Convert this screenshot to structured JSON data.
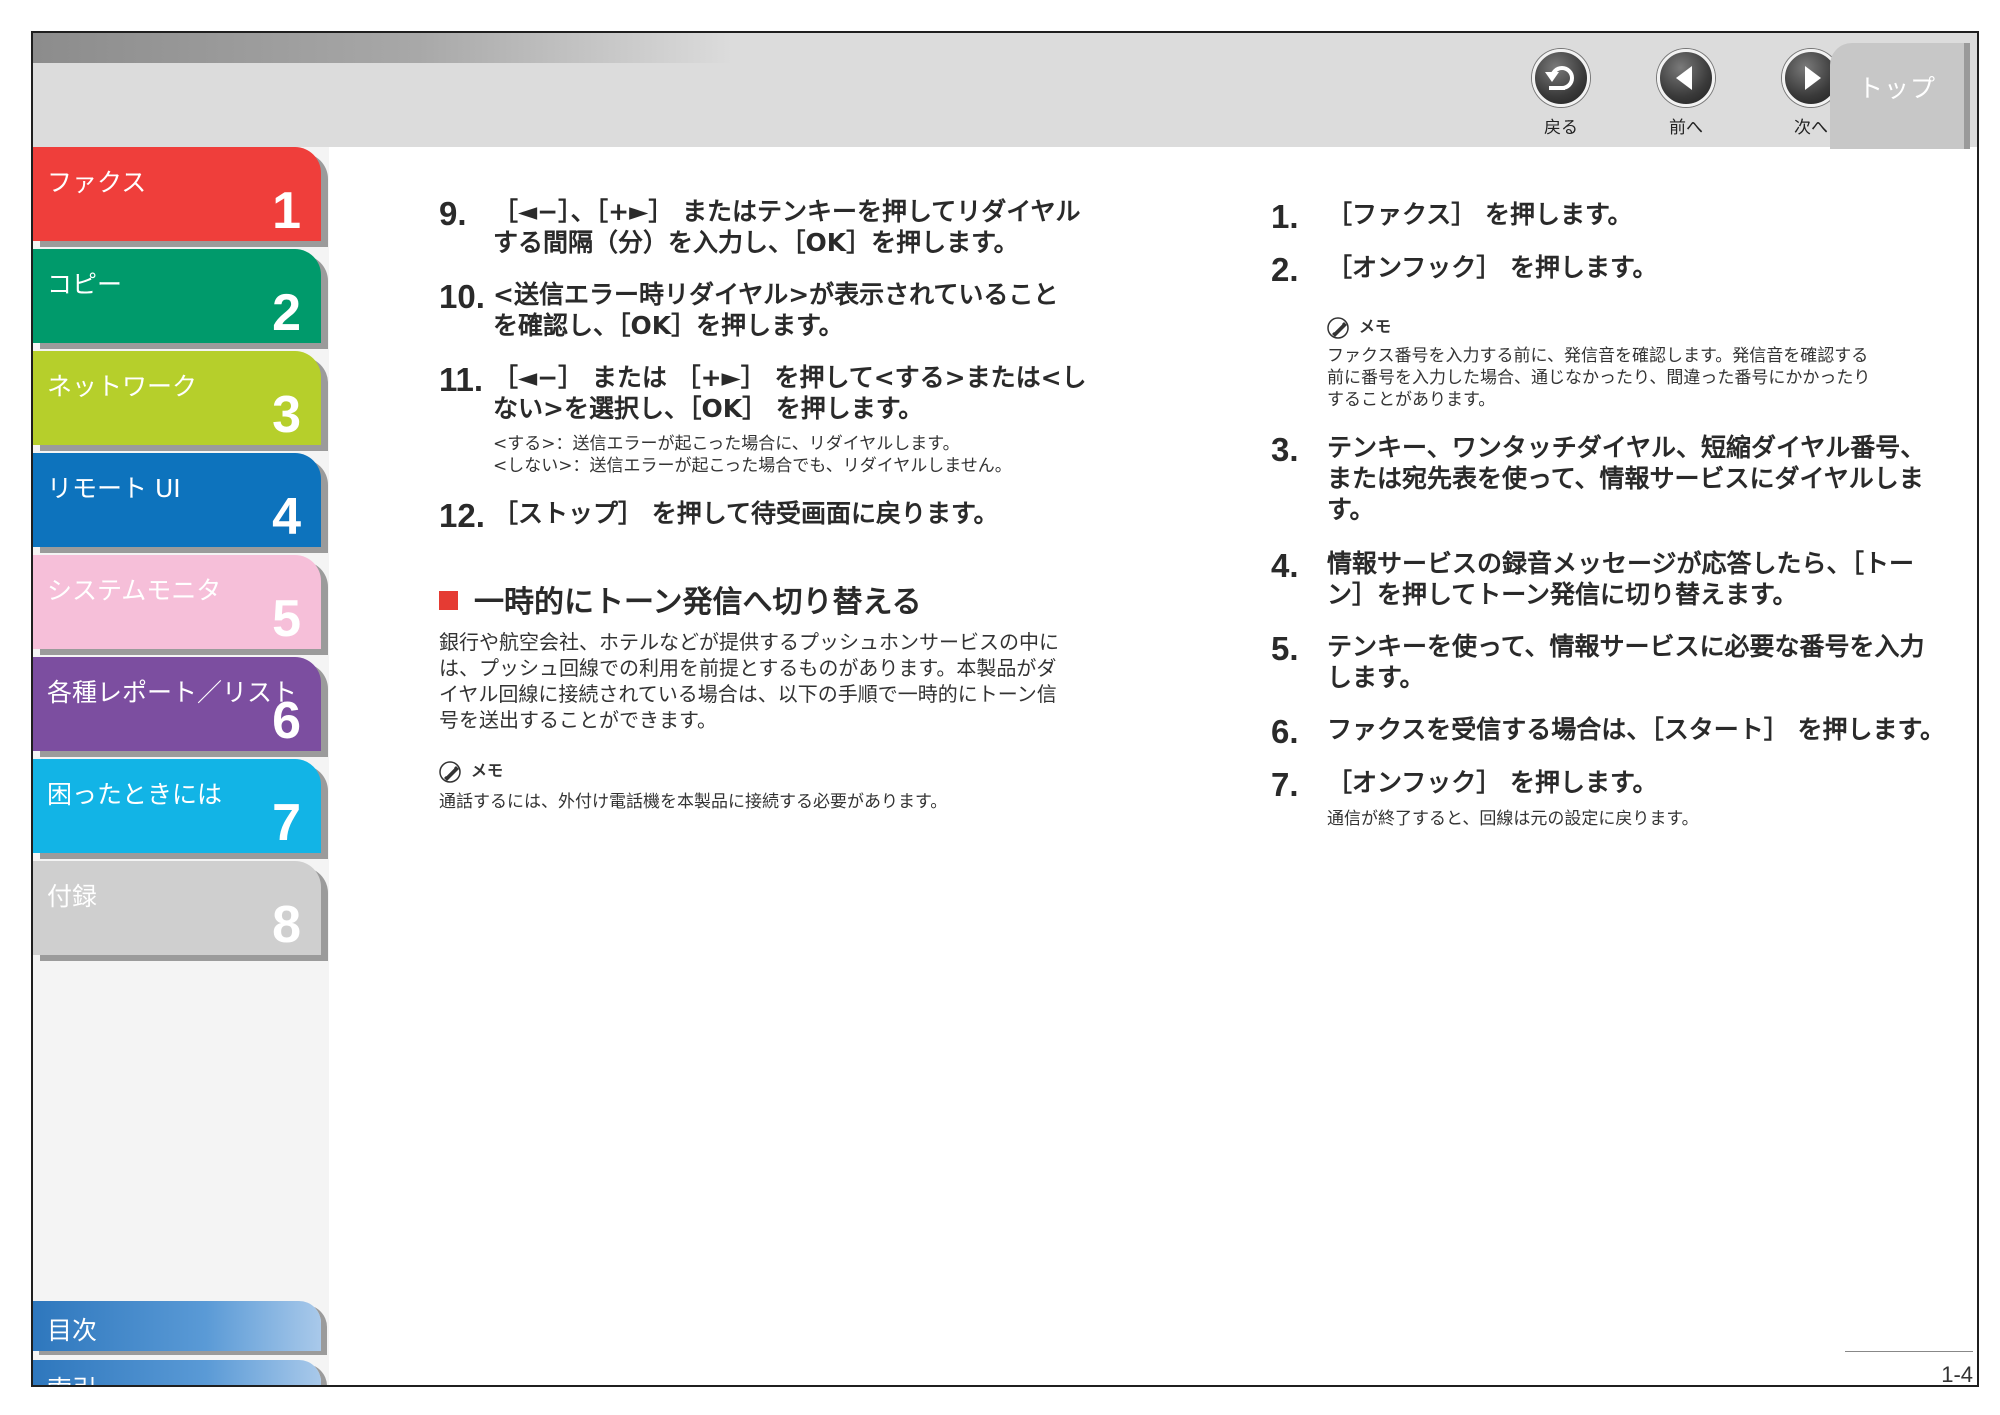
{
  "header": {
    "back_label": "戻る",
    "prev_label": "前へ",
    "next_label": "次へ",
    "top_label": "トップ"
  },
  "sidebar": {
    "chapters": [
      {
        "label": "ファクス",
        "num": "1",
        "color": "#ef3e3b"
      },
      {
        "label": "コピー",
        "num": "2",
        "color": "#009a6b"
      },
      {
        "label": "ネットワーク",
        "num": "3",
        "color": "#b6cf2b"
      },
      {
        "label": "リモート UI",
        "num": "4",
        "color": "#0d73bd"
      },
      {
        "label": "システムモニタ",
        "num": "5",
        "color": "#f6bfd9"
      },
      {
        "label": "各種レポート／リスト",
        "num": "6",
        "color": "#7c4ea0"
      },
      {
        "label": "困ったときには",
        "num": "7",
        "color": "#12b4e6"
      },
      {
        "label": "付録",
        "num": "8",
        "color": "#cfcfcf"
      }
    ],
    "toc_label": "目次",
    "index_label": "索引"
  },
  "left": {
    "steps": [
      {
        "num": "9.",
        "lines": [
          "［◄−］、［+►］ またはテンキーを押してリダイヤル",
          "する間隔（分）を入力し、［OK］を押します。"
        ]
      },
      {
        "num": "10.",
        "lines": [
          "<送信エラー時リダイヤル>が表示されていること",
          "を確認し、［OK］を押します。"
        ]
      },
      {
        "num": "11.",
        "lines": [
          "［◄−］ または ［+►］ を押して<する>または<し",
          "ない>を選択し、［OK］ を押します。"
        ],
        "notes": [
          "<する>：送信エラーが起こった場合に、リダイヤルします。",
          "<しない>：送信エラーが起こった場合でも、リダイヤルしません。"
        ]
      },
      {
        "num": "12.",
        "lines": [
          "［ストップ］ を押して待受画面に戻ります。"
        ]
      }
    ],
    "section_title": "一時的にトーン発信へ切り替える",
    "section_body": [
      "銀行や航空会社、ホテルなどが提供するプッシュホンサービスの中に",
      "は、プッシュ回線での利用を前提とするものがあります。本製品がダ",
      "イヤル回線に接続されている場合は、以下の手順で一時的にトーン信",
      "号を送出することができます。"
    ],
    "memo_title": "メモ",
    "memo_text": "通話するには、外付け電話機を本製品に接続する必要があります。"
  },
  "right": {
    "steps": [
      {
        "num": "1.",
        "lines": [
          "［ファクス］ を押します。"
        ]
      },
      {
        "num": "2.",
        "lines": [
          "［オンフック］ を押します。"
        ]
      },
      {
        "num": "3.",
        "lines": [
          "テンキー、ワンタッチダイヤル、短縮ダイヤル番号、",
          "または宛先表を使って、情報サービスにダイヤルしま",
          "す。"
        ]
      },
      {
        "num": "4.",
        "lines": [
          "情報サービスの録音メッセージが応答したら、［トー",
          "ン］を押してトーン発信に切り替えます。"
        ]
      },
      {
        "num": "5.",
        "lines": [
          "テンキーを使って、情報サービスに必要な番号を入力",
          "します。"
        ]
      },
      {
        "num": "6.",
        "lines": [
          "ファクスを受信する場合は、［スタート］ を押します。"
        ]
      },
      {
        "num": "7.",
        "lines": [
          "［オンフック］ を押します。"
        ]
      }
    ],
    "memo_title": "メモ",
    "memo_lines": [
      "ファクス番号を入力する前に、発信音を確認します。発信音を確認する",
      "前に番号を入力した場合、通じなかったり、間違った番号にかかったり",
      "することがあります。"
    ],
    "step7_note": "通信が終了すると、回線は元の設定に戻ります。"
  },
  "page_number": "1-4"
}
